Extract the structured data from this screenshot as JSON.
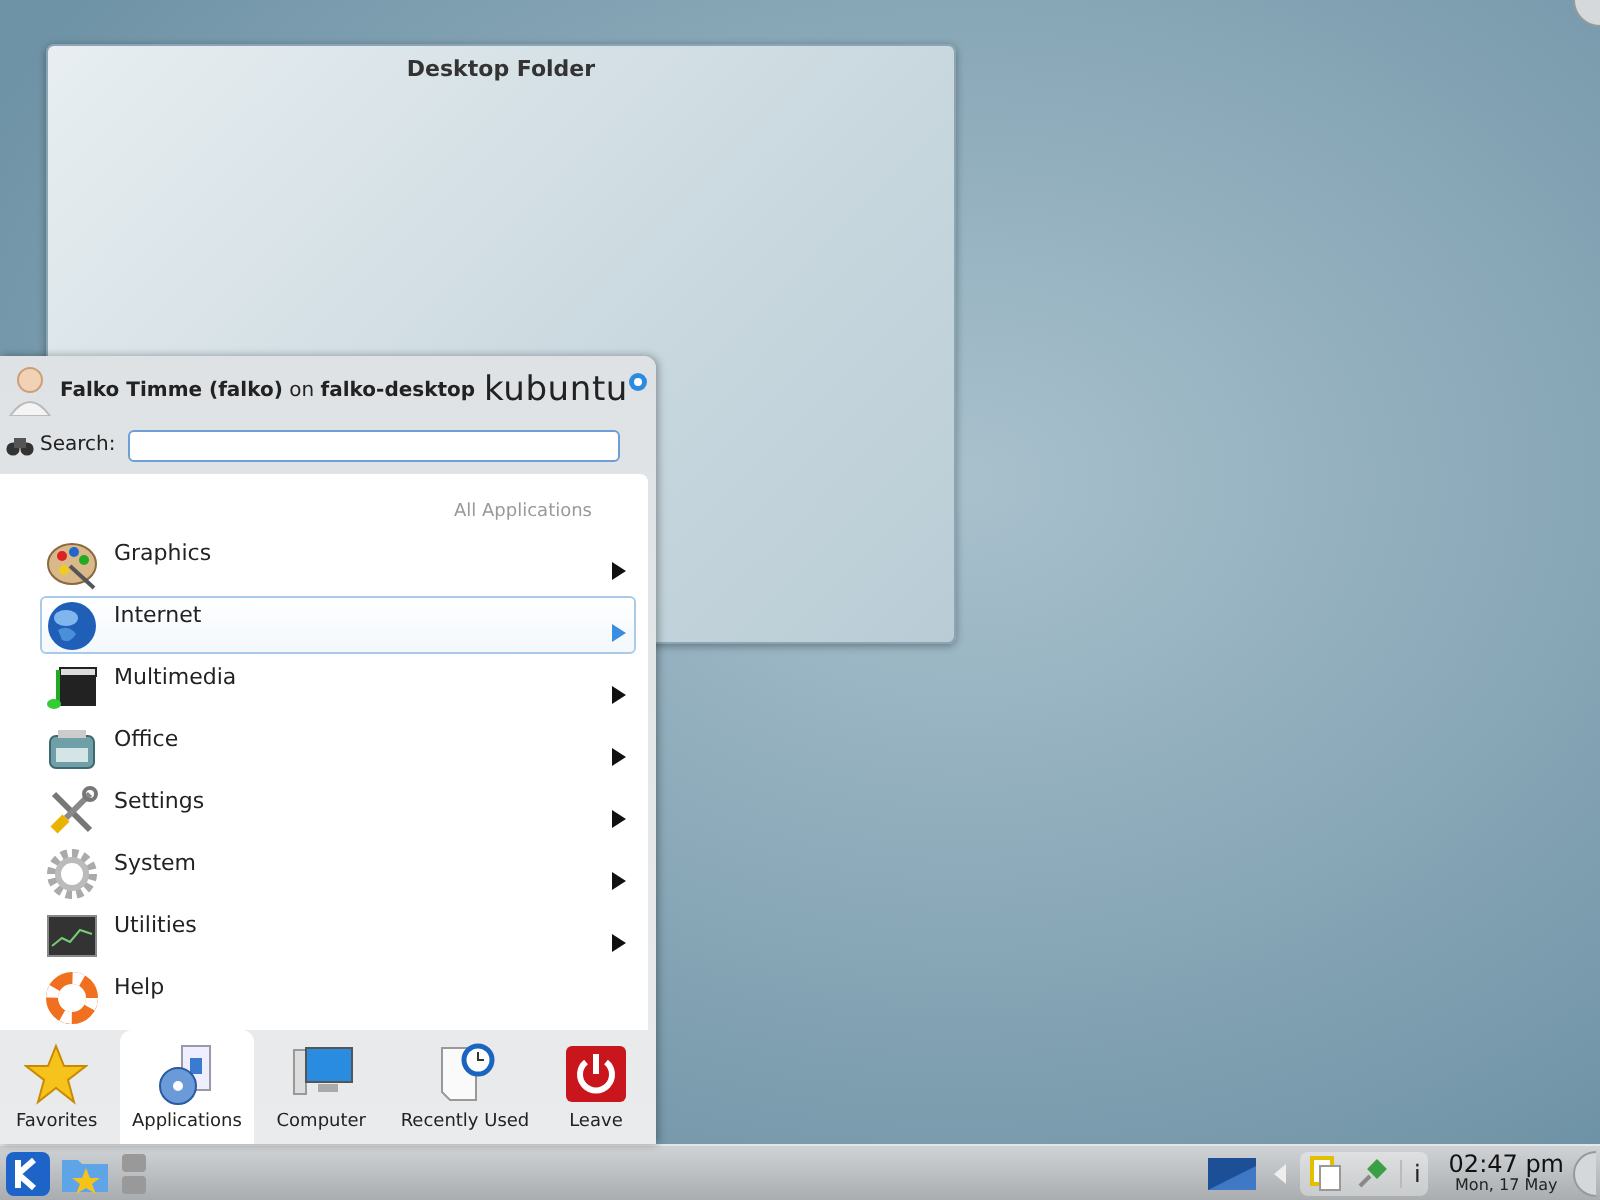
{
  "desktop_folder": {
    "title": "Desktop Folder"
  },
  "launcher": {
    "user": "**Falko Timme (falko)** on **falko-desktop**",
    "brand": "kubuntu",
    "search": {
      "label": "Search:"
    },
    "breadcrumb": "All Applications",
    "items": [
      {
        "label": "Graphics",
        "has_submenu": true,
        "selected": false
      },
      {
        "label": "Internet",
        "has_submenu": true,
        "selected": true
      },
      {
        "label": "Multimedia",
        "has_submenu": true,
        "selected": false
      },
      {
        "label": "Office",
        "has_submenu": true,
        "selected": false
      },
      {
        "label": "Settings",
        "has_submenu": true,
        "selected": false
      },
      {
        "label": "System",
        "has_submenu": true,
        "selected": false
      },
      {
        "label": "Utilities",
        "has_submenu": true,
        "selected": false
      },
      {
        "label": "Help",
        "has_submenu": false,
        "selected": false
      }
    ],
    "tabs": [
      {
        "label": "Favorites",
        "selected": false
      },
      {
        "label": "Applications",
        "selected": true
      },
      {
        "label": "Computer",
        "selected": false
      },
      {
        "label": "Recently Used",
        "selected": false
      },
      {
        "label": "Leave",
        "selected": false
      }
    ]
  },
  "taskbar": {
    "tray_info": "i",
    "clock": {
      "time": "02:47 pm",
      "date": "Mon, 17 May"
    }
  }
}
